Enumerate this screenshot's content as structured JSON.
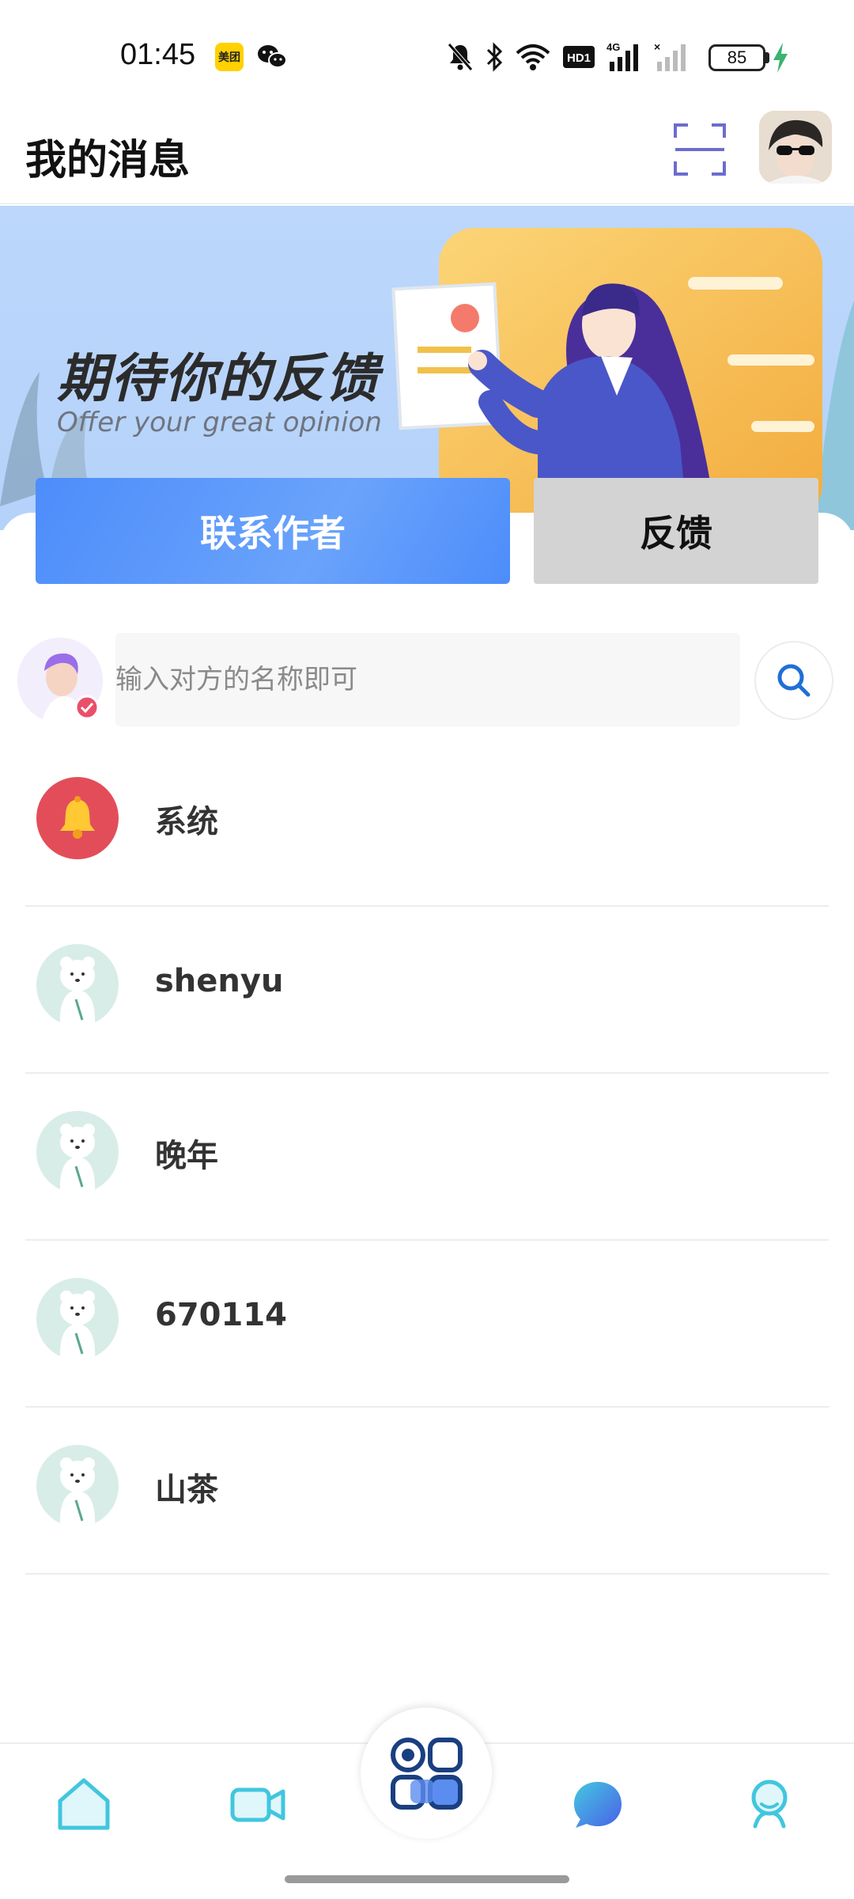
{
  "status_bar": {
    "time": "01:45",
    "meituan_label": "美团",
    "network": "4G",
    "hd_label": "HD1",
    "battery": "85"
  },
  "header": {
    "title": "我的消息"
  },
  "banner": {
    "title_cn": "期待你的反馈",
    "title_en": "Offer your great opinion"
  },
  "buttons": {
    "contact_label": "联系作者",
    "feedback_label": "反馈"
  },
  "search": {
    "placeholder": "输入对方的名称即可"
  },
  "conversations": [
    {
      "name": "系统",
      "avatar": "bell-icon"
    },
    {
      "name": "shenyu",
      "avatar": "bear-avatar"
    },
    {
      "name": "晚年",
      "avatar": "bear-avatar"
    },
    {
      "name": "670114",
      "avatar": "bear-avatar"
    },
    {
      "name": "山茶",
      "avatar": "bear-avatar"
    }
  ],
  "bottom_nav": {
    "items": [
      "home-icon",
      "video-icon",
      "apps-icon",
      "message-icon",
      "profile-icon"
    ],
    "active": "message-icon"
  },
  "colors": {
    "accent_blue": "#4d8dfb",
    "banner_bg": "#bcd7fb",
    "system_red": "#e34d5a",
    "feedback_gray": "#d3d3d3",
    "nav_cyan": "#41c6de"
  }
}
